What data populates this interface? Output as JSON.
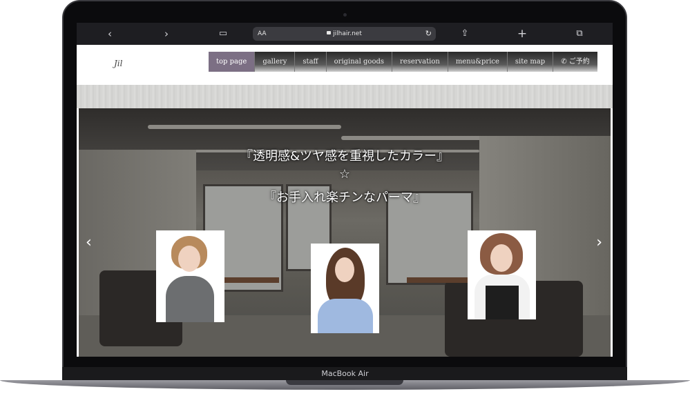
{
  "browser": {
    "aa": "AA",
    "url": "jilhair.net",
    "icons": [
      "chevron-left-icon",
      "chevron-right-icon",
      "book-icon",
      "share-icon",
      "plus-icon",
      "tabs-icon",
      "reload-icon"
    ]
  },
  "site": {
    "logo": "Jil",
    "nav": [
      {
        "label": "top page",
        "active": true
      },
      {
        "label": "gallery"
      },
      {
        "label": "staff"
      },
      {
        "label": "original goods"
      },
      {
        "label": "reservation"
      },
      {
        "label": "menu&price"
      },
      {
        "label": "site map"
      },
      {
        "label": "ご予約",
        "icon": "phone-icon"
      }
    ]
  },
  "hero": {
    "line1": "『透明感&ツヤ感を重視したカラー』",
    "line2": "☆",
    "line3": "『お手入れ楽チンなパーマ』"
  },
  "device": {
    "model": "MacBook Air"
  },
  "colors": {
    "nav_active": "#7c6f84",
    "safari_bar": "#1e1e22"
  }
}
